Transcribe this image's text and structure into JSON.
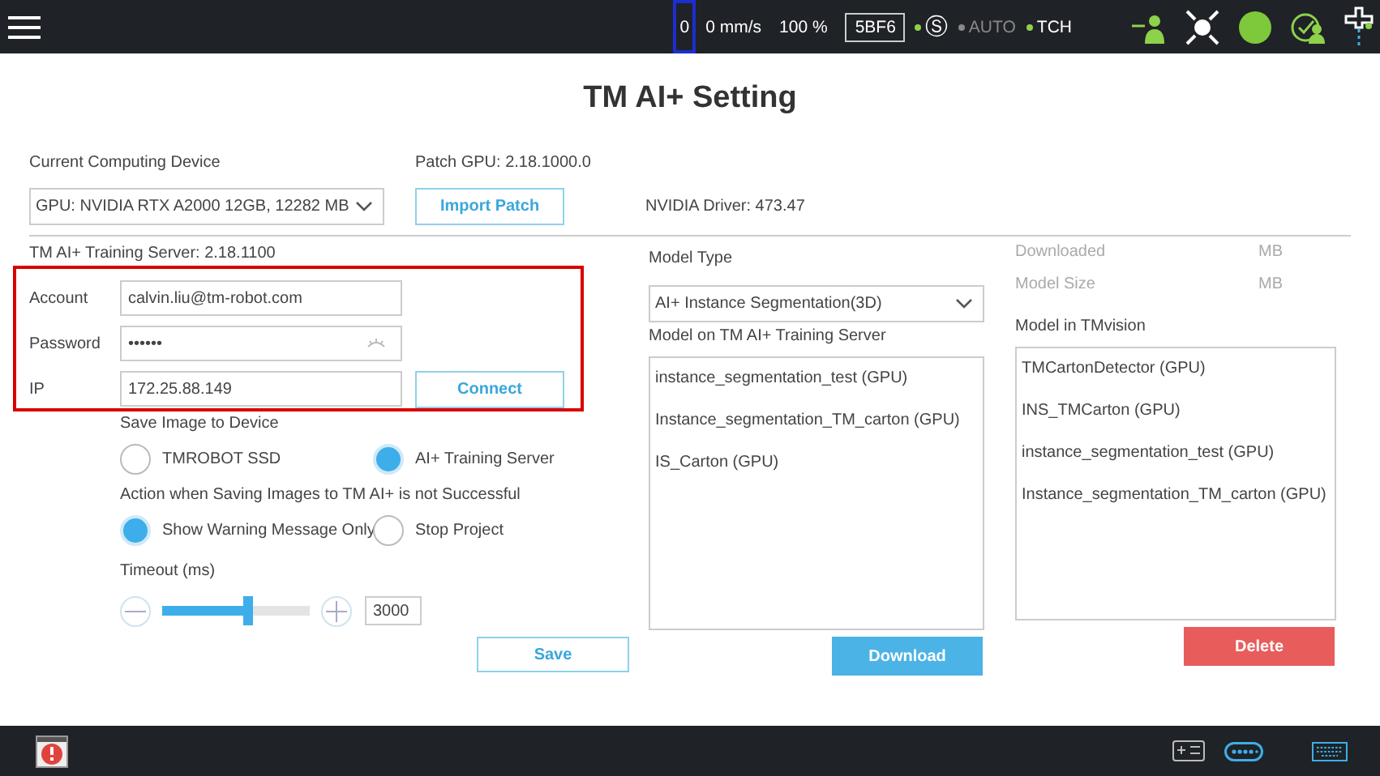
{
  "status_bar": {
    "counter": "0",
    "speed": "0 mm/s",
    "percent": "100 %",
    "code": "5BF6",
    "modes": [
      {
        "label": "Ⓢ",
        "on": true
      },
      {
        "label": "AUTO",
        "on": false
      },
      {
        "label": "TCH",
        "on": true
      }
    ]
  },
  "title": "TM AI+ Setting",
  "device": {
    "label": "Current Computing Device",
    "value": "GPU: NVIDIA RTX A2000 12GB, 12282 MB",
    "patch_label": "Patch GPU: 2.18.1000.0",
    "import_button": "Import Patch",
    "driver": "NVIDIA Driver: 473.47"
  },
  "server": {
    "label": "TM AI+ Training Server: 2.18.1100",
    "account": {
      "label": "Account",
      "value": "calvin.liu@tm-robot.com"
    },
    "password": {
      "label": "Password",
      "value": "••••••"
    },
    "ip": {
      "label": "IP",
      "value": "172.25.88.149"
    },
    "connect_button": "Connect"
  },
  "save_image": {
    "label": "Save Image to Device",
    "options": [
      {
        "label": "TMROBOT SSD",
        "selected": false
      },
      {
        "label": "AI+ Training Server",
        "selected": true
      }
    ]
  },
  "on_failure": {
    "label": "Action when Saving Images to TM AI+ is not Successful",
    "options": [
      {
        "label": "Show Warning Message Only",
        "selected": true
      },
      {
        "label": "Stop Project",
        "selected": false
      }
    ]
  },
  "timeout": {
    "label": "Timeout (ms)",
    "level": 0.58,
    "value": "3000"
  },
  "save_button": "Save",
  "model_type": {
    "label": "Model Type",
    "value": "AI+ Instance Segmentation(3D)"
  },
  "server_models": {
    "label": "Model on TM AI+ Training Server",
    "items": [
      "instance_segmentation_test (GPU)",
      "Instance_segmentation_TM_carton (GPU)",
      "IS_Carton (GPU)"
    ],
    "button": "Download"
  },
  "info": [
    {
      "label": "Downloaded",
      "unit": "MB"
    },
    {
      "label": "Model Size",
      "unit": "MB"
    }
  ],
  "vision_models": {
    "label": "Model in TMvision",
    "items": [
      "TMCartonDetector (GPU)",
      "INS_TMCarton (GPU)",
      "instance_segmentation_test (GPU)",
      "Instance_segmentation_TM_carton (GPU)"
    ],
    "button": "Delete"
  }
}
